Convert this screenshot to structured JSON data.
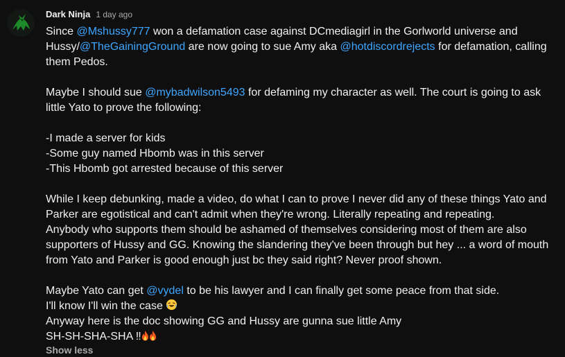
{
  "comment": {
    "avatar_icon": "ninja-silhouette-icon",
    "author": "Dark Ninja",
    "timestamp": "1 day ago",
    "lines": [
      [
        {
          "t": "Since "
        },
        {
          "t": "@Mshussy777",
          "m": true
        },
        {
          "t": " won a defamation case against DCmediagirl in the Gorlworld universe and"
        }
      ],
      [
        {
          "t": "Hussy/"
        },
        {
          "t": "@TheGainingGround",
          "m": true
        },
        {
          "t": " are now going to sue Amy aka "
        },
        {
          "t": "@hotdiscordrejects",
          "m": true
        },
        {
          "t": " for defamation, calling"
        }
      ],
      [
        {
          "t": "them Pedos."
        }
      ],
      [],
      [
        {
          "t": "Maybe I should sue "
        },
        {
          "t": "@mybadwilson5493",
          "m": true
        },
        {
          "t": " for defaming my character as well. The court is going to ask"
        }
      ],
      [
        {
          "t": "little Yato to prove the following:"
        }
      ],
      [],
      [
        {
          "t": "-I made a server for kids"
        }
      ],
      [
        {
          "t": "-Some guy named Hbomb was in this server"
        }
      ],
      [
        {
          "t": "-This Hbomb got arrested because of this server"
        }
      ],
      [],
      [
        {
          "t": "While I keep debunking, made a video, do what I can to prove I never did any of these things Yato and"
        }
      ],
      [
        {
          "t": "Parker are egotistical and can't admit when they're wrong. Literally repeating and repeating."
        }
      ],
      [
        {
          "t": "Anybody who supports them should be ashamed of themselves considering most of them are also"
        }
      ],
      [
        {
          "t": "supporters of Hussy and GG. Knowing the slandering they've been through but hey ... a word of mouth"
        }
      ],
      [
        {
          "t": "from Yato and Parker is good enough just bc they said right? Never proof shown."
        }
      ],
      [],
      [
        {
          "t": "Maybe Yato can get "
        },
        {
          "t": "@vydel",
          "m": true
        },
        {
          "t": " to be his lawyer and I can finally get some peace from that side."
        }
      ],
      [
        {
          "t": "I'll know I'll win the case "
        },
        {
          "e": "laughing-tears-emoji-icon"
        }
      ],
      [
        {
          "t": "Anyway here is the doc showing GG and Hussy are gunna sue little Amy"
        }
      ],
      [
        {
          "t": "SH-SH-SHA-SHA "
        },
        {
          "t": "‼"
        },
        {
          "e": "fire-emoji-icon"
        },
        {
          "e": "fire-emoji-icon"
        }
      ]
    ],
    "show_less_label": "Show less"
  },
  "colors": {
    "background": "#0f0f0f",
    "text": "#f1f1f1",
    "secondary_text": "#aaaaaa",
    "mention": "#3ea6ff"
  }
}
